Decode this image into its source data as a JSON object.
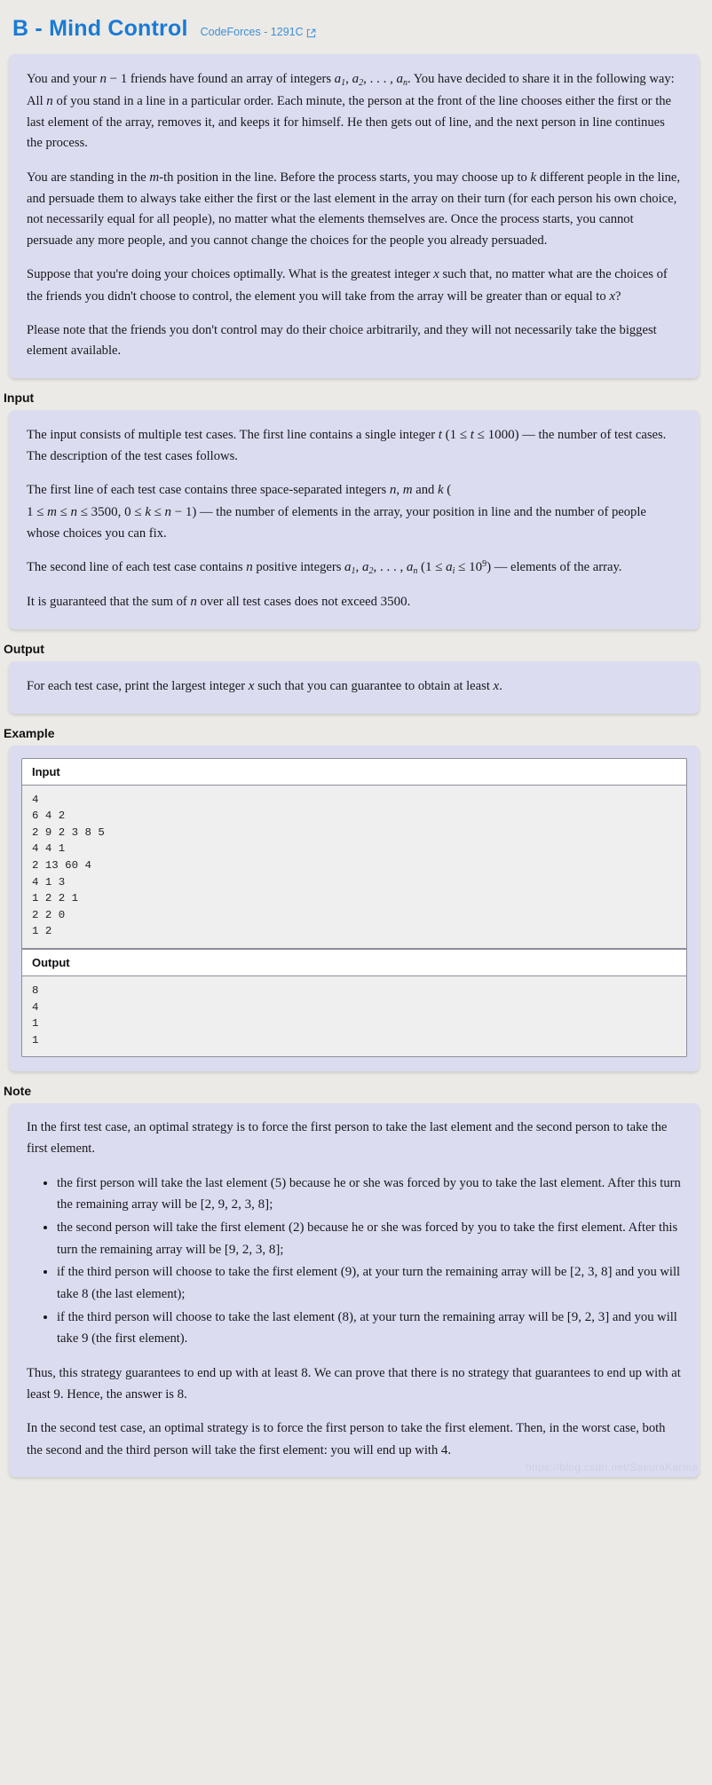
{
  "header": {
    "title": "B - Mind Control",
    "source_label": "CodeForces - 1291C",
    "external_icon": "external-link-icon",
    "title_color": "#1a7bd4",
    "source_color": "#3e8fd6"
  },
  "statement": {
    "paragraphs": [
      "You and your n − 1 friends have found an array of integers a₁, a₂, …, aₙ. You have decided to share it in the following way: All n of you stand in a line in a particular order. Each minute, the person at the front of the line chooses either the first or the last element of the array, removes it, and keeps it for himself. He then gets out of line, and the next person in line continues the process.",
      "You are standing in the m-th position in the line. Before the process starts, you may choose up to k different people in the line, and persuade them to always take either the first or the last element in the array on their turn (for each person his own choice, not necessarily equal for all people), no matter what the elements themselves are. Once the process starts, you cannot persuade any more people, and you cannot change the choices for the people you already persuaded.",
      "Suppose that you're doing your choices optimally. What is the greatest integer x such that, no matter what are the choices of the friends you didn't choose to control, the element you will take from the array will be greater than or equal to x?",
      "Please note that the friends you don't control may do their choice arbitrarily, and they will not necessarily take the biggest element available."
    ]
  },
  "input_section": {
    "heading": "Input",
    "paragraphs": [
      "The input consists of multiple test cases. The first line contains a single integer t (1 ≤ t ≤ 1000) — the number of test cases. The description of the test cases follows.",
      "The first line of each test case contains three space-separated integers n, m and k (1 ≤ m ≤ n ≤ 3500, 0 ≤ k ≤ n − 1) — the number of elements in the array, your position in line and the number of people whose choices you can fix.",
      "The second line of each test case contains n positive integers a₁, a₂, …, aₙ (1 ≤ aᵢ ≤ 10⁹) — elements of the array.",
      "It is guaranteed that the sum of n over all test cases does not exceed 3500."
    ]
  },
  "output_section": {
    "heading": "Output",
    "paragraphs": [
      "For each test case, print the largest integer x such that you can guarantee to obtain at least x."
    ]
  },
  "example_section": {
    "heading": "Example",
    "input_label": "Input",
    "output_label": "Output",
    "input_text": "4\n6 4 2\n2 9 2 3 8 5\n4 4 1\n2 13 60 4\n4 1 3\n1 2 2 1\n2 2 0\n1 2",
    "output_text": "8\n4\n1\n1"
  },
  "note_section": {
    "heading": "Note",
    "intro": "In the first test case, an optimal strategy is to force the first person to take the last element and the second person to take the first element.",
    "bullets": [
      "the first person will take the last element (5) because he or she was forced by you to take the last element. After this turn the remaining array will be [2, 9, 2, 3, 8];",
      "the second person will take the first element (2) because he or she was forced by you to take the first element. After this turn the remaining array will be [9, 2, 3, 8];",
      "if the third person will choose to take the first element (9), at your turn the remaining array will be [2, 3, 8] and you will take 8 (the last element);",
      "if the third person will choose to take the last element (8), at your turn the remaining array will be [9, 2, 3] and you will take 9 (the first element)."
    ],
    "closing_paragraphs": [
      "Thus, this strategy guarantees to end up with at least 8. We can prove that there is no strategy that guarantees to end up with at least 9. Hence, the answer is 8.",
      "In the second test case, an optimal strategy is to force the first person to take the first element. Then, in the worst case, both the second and the third person will take the first element: you will end up with 4."
    ]
  },
  "watermark": {
    "text": "https://blog.csdn.net/SakuraKarma"
  }
}
